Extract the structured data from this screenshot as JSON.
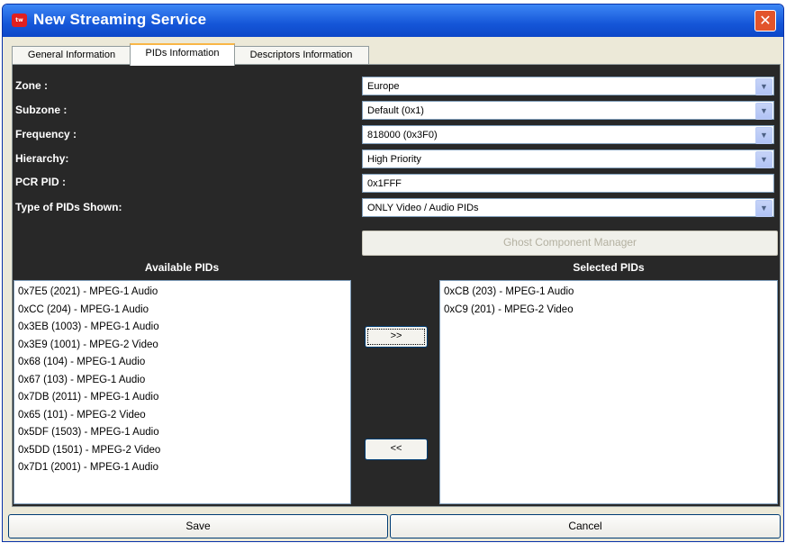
{
  "window": {
    "title": "New Streaming Service",
    "app_icon_text": "tw",
    "close_symbol": "✕",
    "accent": "#1556d8"
  },
  "tabs": [
    {
      "label": "General Information",
      "active": false
    },
    {
      "label": "PIDs Information",
      "active": true
    },
    {
      "label": "Descriptors Information",
      "active": false
    }
  ],
  "form": {
    "zone": {
      "label": "Zone :",
      "value": "Europe"
    },
    "subzone": {
      "label": "Subzone :",
      "value": "Default (0x1)"
    },
    "frequency": {
      "label": "Frequency :",
      "value": "818000 (0x3F0)"
    },
    "hierarchy": {
      "label": "Hierarchy:",
      "value": "High Priority"
    },
    "pcr_pid": {
      "label": "PCR PID :",
      "value": "0x1FFF"
    },
    "pid_type": {
      "label": "Type of PIDs Shown:",
      "value": "ONLY Video / Audio PIDs"
    }
  },
  "dropdown_arrow": "▼",
  "ghost_button": "Ghost Component Manager",
  "available": {
    "header": "Available PIDs",
    "items": [
      "0x7E5 (2021)  -  MPEG-1 Audio",
      "0xCC (204)  -  MPEG-1 Audio",
      "0x3EB (1003)  -  MPEG-1 Audio",
      "0x3E9 (1001)  -  MPEG-2 Video",
      "0x68 (104)  -  MPEG-1 Audio",
      "0x67 (103)  -  MPEG-1 Audio",
      "0x7DB (2011)  -  MPEG-1 Audio",
      "0x65 (101)  -  MPEG-2 Video",
      "0x5DF (1503)  -  MPEG-1 Audio",
      "0x5DD (1501)  -  MPEG-2 Video",
      "0x7D1 (2001)  -  MPEG-1 Audio"
    ]
  },
  "selected": {
    "header": "Selected PIDs",
    "items": [
      "0xCB (203)  -  MPEG-1 Audio",
      "0xC9 (201)  -  MPEG-2 Video"
    ]
  },
  "move_right": ">>",
  "move_left": "<<",
  "footer": {
    "save": "Save",
    "cancel": "Cancel"
  }
}
